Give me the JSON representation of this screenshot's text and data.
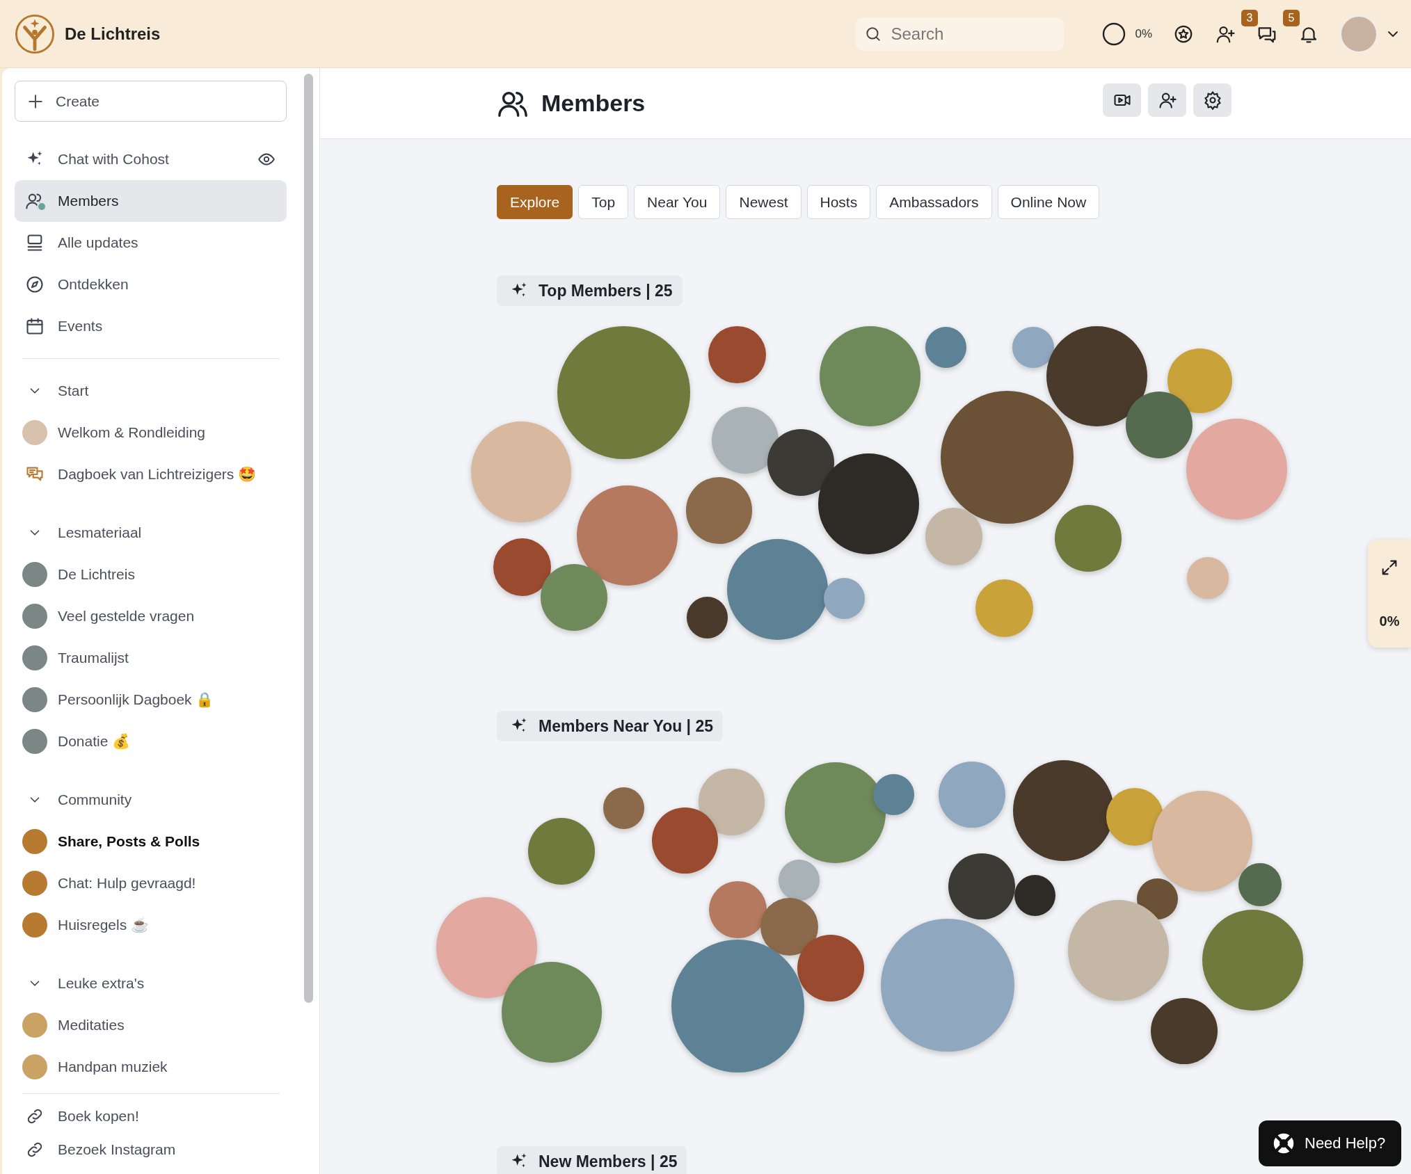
{
  "topbar": {
    "brand": "De Lichtreis",
    "search": {
      "placeholder": "Search"
    },
    "progress": {
      "reading": "0%"
    },
    "icons": [
      {
        "kind": "star"
      },
      {
        "kind": "add-member"
      },
      {
        "kind": "chat",
        "badge": "3"
      },
      {
        "kind": "bell",
        "badge": "5"
      }
    ]
  },
  "sidebar": {
    "create_button": "Create",
    "nav": [
      {
        "label": "Chat with Cohost",
        "kind": "assistant",
        "selected": false
      },
      {
        "label": "Members",
        "kind": "members",
        "selected": true
      },
      {
        "label": "Alle updates",
        "kind": "feed",
        "selected": false
      },
      {
        "label": "Ontdekken",
        "kind": "explore",
        "selected": false
      },
      {
        "label": "Events",
        "kind": "events",
        "selected": false
      }
    ],
    "sections": [
      {
        "title": "Start",
        "expanded": true,
        "items": [
          {
            "label": "Welkom & Rondleiding",
            "kind": "avatar",
            "unread": false
          },
          {
            "label": "Dagboek van Lichtreizigers 🤩",
            "kind": "chat",
            "unread": false
          }
        ]
      },
      {
        "title": "Lesmateriaal",
        "expanded": true,
        "items": [
          {
            "label": "De Lichtreis",
            "kind": "dot",
            "color": "#7a8784",
            "unread": false
          },
          {
            "label": "Veel gestelde vragen",
            "kind": "dot",
            "color": "#7a8784",
            "unread": false
          },
          {
            "label": "Traumalijst",
            "kind": "dot",
            "color": "#7a8784",
            "unread": false
          },
          {
            "label": "Persoonlijk Dagboek 🔒",
            "kind": "dot",
            "color": "#7a8784",
            "unread": false
          },
          {
            "label": "Donatie 💰",
            "kind": "dot",
            "color": "#7a8784",
            "unread": false
          }
        ]
      },
      {
        "title": "Community",
        "expanded": true,
        "items": [
          {
            "label": "Share, Posts & Polls",
            "kind": "dot",
            "color": "#b87a30",
            "unread": true
          },
          {
            "label": "Chat: Hulp gevraagd!",
            "kind": "dot",
            "color": "#b87a30",
            "unread": false
          },
          {
            "label": "Huisregels ☕",
            "kind": "dot",
            "color": "#b87a30",
            "unread": false
          }
        ]
      },
      {
        "title": "Leuke extra's",
        "expanded": true,
        "items": [
          {
            "label": "Meditaties",
            "kind": "dot",
            "color": "#c9a264",
            "unread": false
          },
          {
            "label": "Handpan muziek",
            "kind": "dot",
            "color": "#c9a264",
            "unread": false
          }
        ]
      }
    ],
    "links": [
      {
        "label": "Boek kopen!"
      },
      {
        "label": "Bezoek Instagram"
      }
    ]
  },
  "main": {
    "title": "Members",
    "actions": [
      {
        "kind": "video"
      },
      {
        "kind": "add-member"
      },
      {
        "kind": "settings"
      }
    ],
    "tabs": [
      {
        "label": "Explore",
        "selected": true
      },
      {
        "label": "Top",
        "selected": false
      },
      {
        "label": "Near You",
        "selected": false
      },
      {
        "label": "Newest",
        "selected": false
      },
      {
        "label": "Hosts",
        "selected": false
      },
      {
        "label": "Ambassadors",
        "selected": false
      },
      {
        "label": "Online Now",
        "selected": false
      }
    ],
    "sections": [
      {
        "title": "Top Members | 25"
      },
      {
        "title": "Members Near You | 25"
      },
      {
        "title": "New Members | 25"
      }
    ]
  },
  "side_widget": {
    "reading": "0%"
  },
  "help_button": {
    "label": "Need Help?"
  }
}
